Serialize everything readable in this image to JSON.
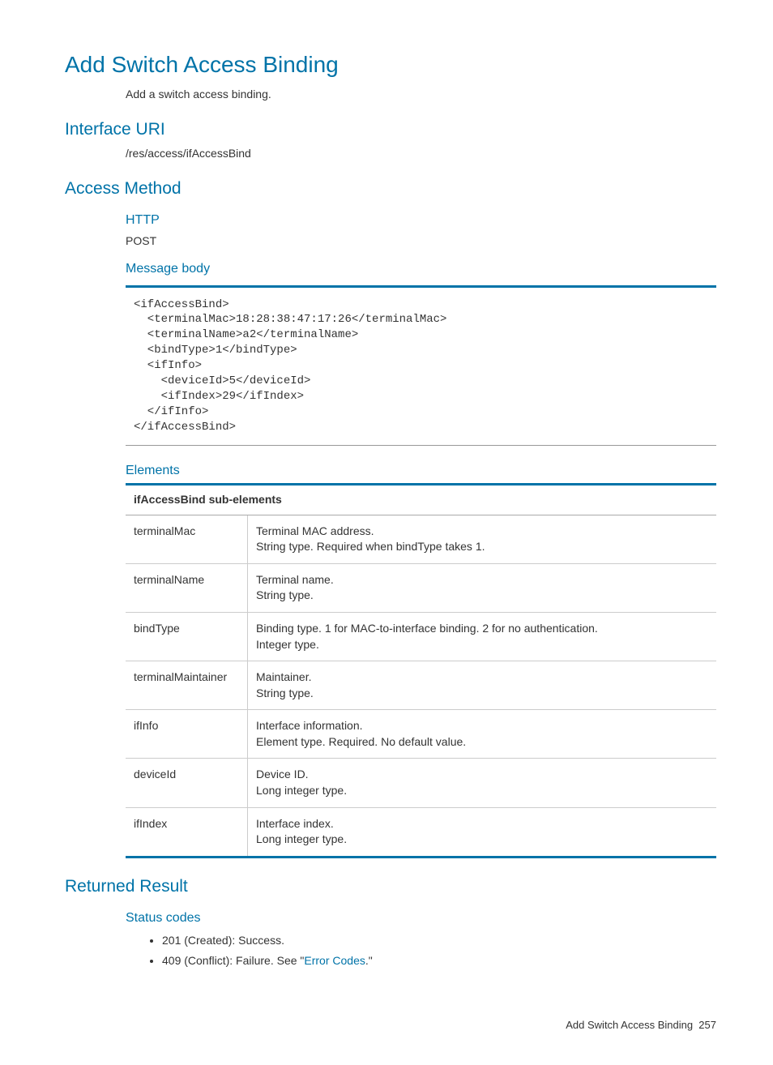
{
  "title": "Add Switch Access Binding",
  "description": "Add a switch access binding.",
  "sections": {
    "interface_uri": {
      "heading": "Interface URI",
      "value": "/res/access/ifAccessBind"
    },
    "access_method": {
      "heading": "Access Method",
      "http_label": "HTTP",
      "http_value": "POST",
      "message_body_label": "Message body",
      "code": "<ifAccessBind>\n  <terminalMac>18:28:38:47:17:26</terminalMac>\n  <terminalName>a2</terminalName>\n  <bindType>1</bindType>\n  <ifInfo>\n    <deviceId>5</deviceId>\n    <ifIndex>29</ifIndex>\n  </ifInfo>\n</ifAccessBind>",
      "elements_label": "Elements",
      "table_header": "ifAccessBind sub-elements",
      "rows": [
        {
          "name": "terminalMac",
          "desc": "Terminal MAC address.\nString type. Required when bindType takes 1."
        },
        {
          "name": "terminalName",
          "desc": "Terminal name.\nString type."
        },
        {
          "name": "bindType",
          "desc": "Binding type. 1 for MAC-to-interface binding. 2 for no authentication.\nInteger type."
        },
        {
          "name": "terminalMaintainer",
          "desc": "Maintainer.\nString type."
        },
        {
          "name": "ifInfo",
          "desc": "Interface information.\nElement type. Required. No default value."
        },
        {
          "name": "deviceId",
          "desc": "Device ID.\nLong integer type."
        },
        {
          "name": "ifIndex",
          "desc": "Interface index.\nLong integer type."
        }
      ]
    },
    "returned_result": {
      "heading": "Returned Result",
      "status_codes_label": "Status codes",
      "codes": [
        {
          "text_before": "201 (Created): Success."
        },
        {
          "text_before": "409 (Conflict): Failure. See \"",
          "link": "Error Codes",
          "text_after": ".\""
        }
      ]
    }
  },
  "footer": {
    "title": "Add Switch Access Binding",
    "page": "257"
  }
}
